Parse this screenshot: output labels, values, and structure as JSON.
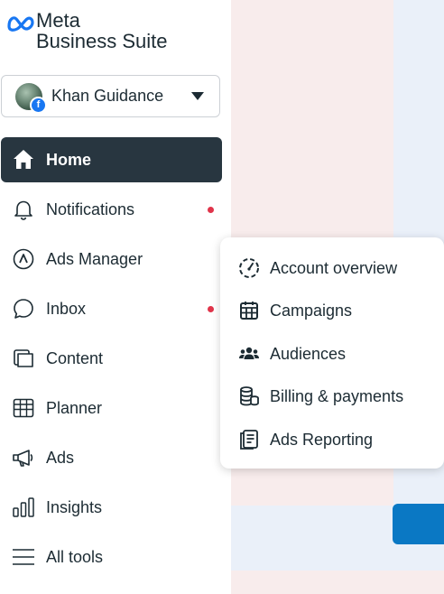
{
  "brand": {
    "line1": "Meta",
    "line2": "Business Suite",
    "color": "#1877f2"
  },
  "account": {
    "name": "Khan Guidance",
    "avatar_icon": "profile-photo",
    "badge_icon": "facebook-icon"
  },
  "nav": [
    {
      "label": "Home",
      "icon": "home-icon",
      "active": true
    },
    {
      "label": "Notifications",
      "icon": "bell-icon",
      "dot": true
    },
    {
      "label": "Ads Manager",
      "icon": "ads-manager-icon"
    },
    {
      "label": "Inbox",
      "icon": "chat-bubble-icon",
      "dot": true
    },
    {
      "label": "Content",
      "icon": "content-icon"
    },
    {
      "label": "Planner",
      "icon": "calendar-grid-icon"
    },
    {
      "label": "Ads",
      "icon": "megaphone-icon"
    },
    {
      "label": "Insights",
      "icon": "bar-chart-icon"
    },
    {
      "label": "All tools",
      "icon": "menu-icon"
    }
  ],
  "ads_submenu": [
    {
      "label": "Account overview",
      "icon": "gauge-icon"
    },
    {
      "label": "Campaigns",
      "icon": "campaign-calendar-icon"
    },
    {
      "label": "Audiences",
      "icon": "people-icon"
    },
    {
      "label": "Billing & payments",
      "icon": "coins-icon"
    },
    {
      "label": "Ads Reporting",
      "icon": "report-icon"
    }
  ],
  "colors": {
    "active_bg": "#283640",
    "notification_dot": "#e0344a",
    "primary_button": "#0a78c4"
  }
}
